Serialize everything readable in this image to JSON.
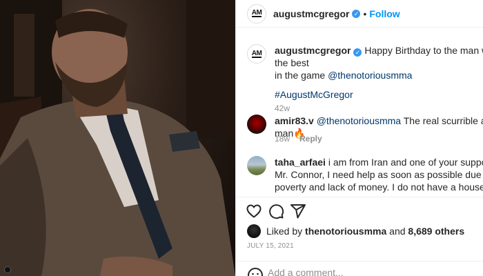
{
  "post": {
    "author": "augustmcgregor",
    "avatar_text": "AM",
    "follow_label": "Follow",
    "dot": "•"
  },
  "caption": {
    "author": "augustmcgregor",
    "text": "Happy Birthday to the man with the best",
    "text_line2": "in the game",
    "mention": "@thenotoriousmma",
    "hashtag": "#AugustMcGregor",
    "age": "42w"
  },
  "comments": [
    {
      "author": "amir83.v",
      "mention": "@thenotoriousmma",
      "text": "The real scurrible alpha man",
      "emoji": "🔥",
      "age": "18w",
      "reply_label": "Reply"
    },
    {
      "author": "taha_arfaei",
      "text": "i am from Iran and one of your supporters. Mr. Connor, I need help as soon as possible due to my poverty and lack of money. I do not have a house to live in. I can not rent a house with a low income. Help me, Mr. Connor."
    }
  ],
  "likes": {
    "prefix": "Liked by",
    "user": "thenotoriousmma",
    "and": "and",
    "others": "8,689 others"
  },
  "date": "JULY 15, 2021",
  "add_comment": {
    "placeholder": "Add a comment..."
  },
  "icons": {
    "like": "heart-icon",
    "comment": "comment-icon",
    "share": "share-icon",
    "emoji": "smile-icon",
    "verified": "verified-badge-icon"
  },
  "colors": {
    "follow": "#0095f6",
    "link": "#00376b",
    "verified": "#3897f0",
    "muted": "#8e8e8e"
  }
}
